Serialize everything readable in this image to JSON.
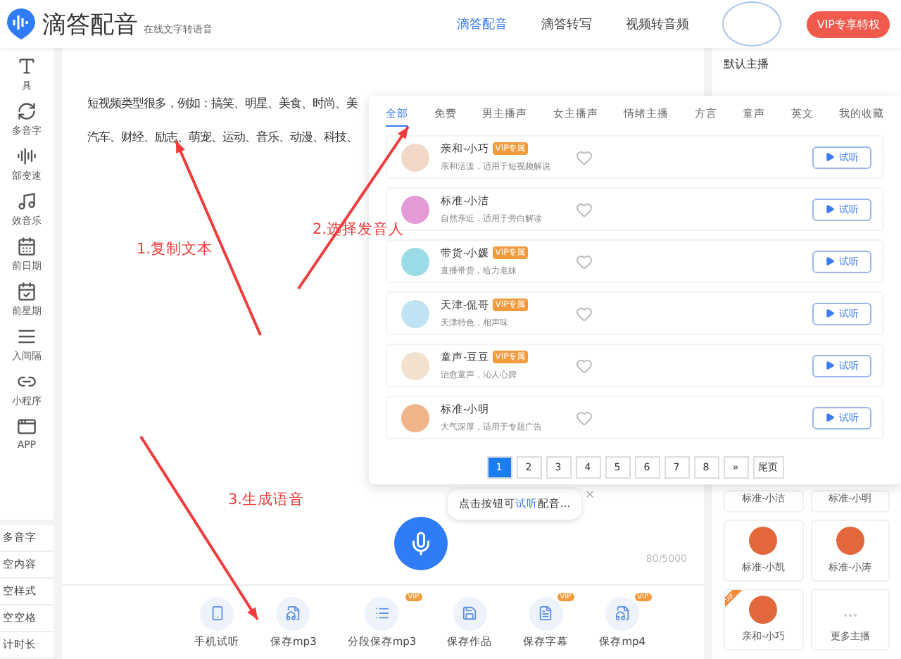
{
  "header": {
    "brand": "滴答配音",
    "tagline": "在线文字转语音",
    "nav": [
      {
        "label": "滴答配音",
        "selected": true
      },
      {
        "label": "滴答转写",
        "selected": false
      },
      {
        "label": "视频转音频",
        "selected": false
      }
    ],
    "vip_button": "VIP专享特权"
  },
  "tools": [
    "具",
    "多音字",
    "部变速",
    "效音乐",
    "前日期",
    "前星期",
    "入间隔",
    "小程序",
    "APP"
  ],
  "actions": [
    "多音字",
    "空内容",
    "空样式",
    "空空格",
    "计时长"
  ],
  "editor": {
    "lines": [
      "短视频类型很多，例如：搞笑、明星、美食、时尚、美",
      "汽车、财经、励志、萌宠、运动、音乐、动漫、科技、"
    ],
    "tooltip": {
      "before": "点击按钮可",
      "link": "试听",
      "after": "配音..."
    },
    "counter": "80/5000"
  },
  "toolbar": [
    {
      "label": "手机试听"
    },
    {
      "label": "保存mp3"
    },
    {
      "label": "分段保存mp3",
      "badge": "VIP"
    },
    {
      "label": "保存作品"
    },
    {
      "label": "保存字幕",
      "badge": "VIP"
    },
    {
      "label": "保存mp4",
      "badge": "VIP"
    }
  ],
  "right_panel": {
    "title": "默认主播",
    "cards": [
      {
        "name": "标准-小洁",
        "kind": "label"
      },
      {
        "name": "标准-小明",
        "kind": "label"
      },
      {
        "name": "标准-小凯",
        "kind": "avatar"
      },
      {
        "name": "标准-小涛",
        "kind": "avatar"
      },
      {
        "name": "亲和-小巧",
        "kind": "avatar",
        "ribbon": "VIP"
      },
      {
        "name": "更多主播",
        "kind": "more"
      }
    ]
  },
  "voice_picker": {
    "tabs": [
      {
        "label": "全部",
        "selected": true
      },
      {
        "label": "免费",
        "selected": false
      },
      {
        "label": "男主播声",
        "selected": false
      },
      {
        "label": "女主播声",
        "selected": false
      },
      {
        "label": "情绪主播",
        "selected": false
      },
      {
        "label": "方言",
        "selected": false
      },
      {
        "label": "童声",
        "selected": false
      },
      {
        "label": "英文",
        "selected": false
      },
      {
        "label": "我的收藏",
        "selected": false
      }
    ],
    "voices": [
      {
        "name": "亲和-小巧",
        "badge": "VIP专属",
        "desc": "亲和活泼，适用于短视频解说",
        "color": "#f2d8c8",
        "play": "试听"
      },
      {
        "name": "标准-小洁",
        "desc": "自然亲近，适用于旁白解读",
        "color": "#e59ad8",
        "play": "试听"
      },
      {
        "name": "带货-小媛",
        "badge": "VIP专属",
        "desc": "直播带货，给力老妹",
        "color": "#9adbe6",
        "play": "试听"
      },
      {
        "name": "天津-侃哥",
        "badge": "VIP专属",
        "desc": "天津特色，相声味",
        "color": "#bfe3f2",
        "play": "试听"
      },
      {
        "name": "童声-豆豆",
        "badge": "VIP专属",
        "desc": "治愈童声，沁人心脾",
        "color": "#f3e1cf",
        "play": "试听"
      },
      {
        "name": "标准-小明",
        "desc": "大气深厚，适用于专题广告",
        "color": "#f0b48a",
        "play": "试听"
      }
    ],
    "pages": [
      {
        "label": "1",
        "selected": true
      },
      {
        "label": "2",
        "selected": false
      },
      {
        "label": "3",
        "selected": false
      },
      {
        "label": "4",
        "selected": false
      },
      {
        "label": "5",
        "selected": false
      },
      {
        "label": "6",
        "selected": false
      },
      {
        "label": "7",
        "selected": false
      },
      {
        "label": "8",
        "selected": false
      },
      {
        "label": "»",
        "selected": false
      },
      {
        "label": "尾页",
        "selected": false
      }
    ]
  },
  "annotations": [
    "1.复制文本",
    "2.选择发音人",
    "3.生成语音"
  ]
}
